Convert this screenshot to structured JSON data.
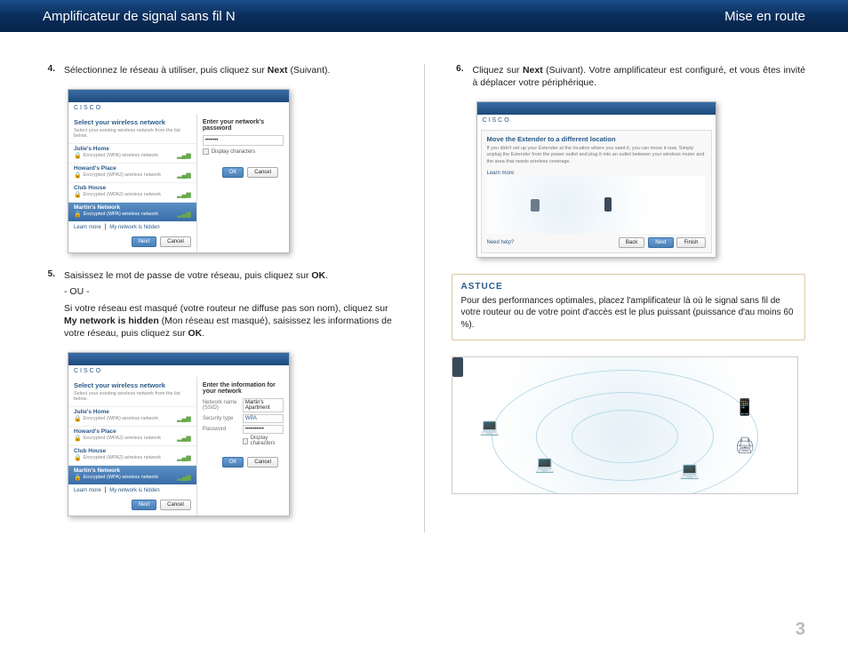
{
  "header": {
    "left": "Amplificateur de signal sans fil N",
    "right": "Mise en route"
  },
  "steps": {
    "s4": {
      "num": "4.",
      "text_a": "Sélectionnez le réseau à utiliser, puis cliquez sur ",
      "bold": "Next",
      "text_b": " (Suivant)."
    },
    "s5": {
      "num": "5.",
      "text_a": "Saisissez le mot de passe de votre réseau, puis cliquez sur ",
      "bold": "OK",
      "text_b": ".",
      "or": "- OU -",
      "p2_a": "Si votre réseau est masqué (votre routeur ne diffuse pas son nom), cliquez sur ",
      "p2_bold1": "My network is hidden",
      "p2_mid": " (Mon réseau est masqué), saisissez les informations de votre réseau, puis cliquez sur ",
      "p2_bold2": "OK",
      "p2_end": "."
    },
    "s6": {
      "num": "6.",
      "text_a": "Cliquez sur ",
      "bold": "Next",
      "text_b": " (Suivant). Votre amplificateur est configuré, et vous êtes invité à déplacer votre périphérique."
    }
  },
  "screenshot_common": {
    "brand": "CISCO",
    "title": "Select your wireless network",
    "subtitle": "Select your existing wireless network from the list below.",
    "networks": [
      {
        "name": "Julie's Home",
        "desc": "Encrypted (WPA) wireless network"
      },
      {
        "name": "Howard's Place",
        "desc": "Encrypted (WPA2) wireless network"
      },
      {
        "name": "Club House",
        "desc": "Encrypted (WPA2) wireless network"
      },
      {
        "name": "Martin's Network",
        "desc": "Encrypted (WPA) wireless network"
      }
    ],
    "link_learn": "Learn more",
    "link_hidden": "My network is hidden",
    "btn_next": "Next",
    "btn_cancel": "Cancel",
    "btn_ok": "OK",
    "btn_back": "Back",
    "btn_finish": "Finish"
  },
  "ss1_right": {
    "title": "Enter your network's password",
    "password_mask": "•••••••",
    "checkbox": "Display characters"
  },
  "ss2_right": {
    "title": "Enter the information for your network",
    "row1_label": "Network name (SSID)",
    "row1_val": "Martin's Apartment",
    "row2_label": "Security type",
    "row2_val": "WPA",
    "row3_label": "Password",
    "row3_val": "••••••••••",
    "checkbox": "Display characters"
  },
  "ss3": {
    "title": "Move the Extender to a different location",
    "subtitle": "If you didn't set up your Extender at the location where you want it, you can move it now. Simply unplug the Extender from the power outlet and plug it into an outlet between your wireless router and the area that needs wireless coverage.",
    "link": "Learn more",
    "foot_link": "Need help?"
  },
  "tip": {
    "title": "ASTUCE",
    "body": "Pour des performances optimales, placez l'amplificateur là où le signal sans fil de votre routeur ou de votre point d'accès est le plus puissant (puissance d'au moins 60 %)."
  },
  "page_number": "3"
}
